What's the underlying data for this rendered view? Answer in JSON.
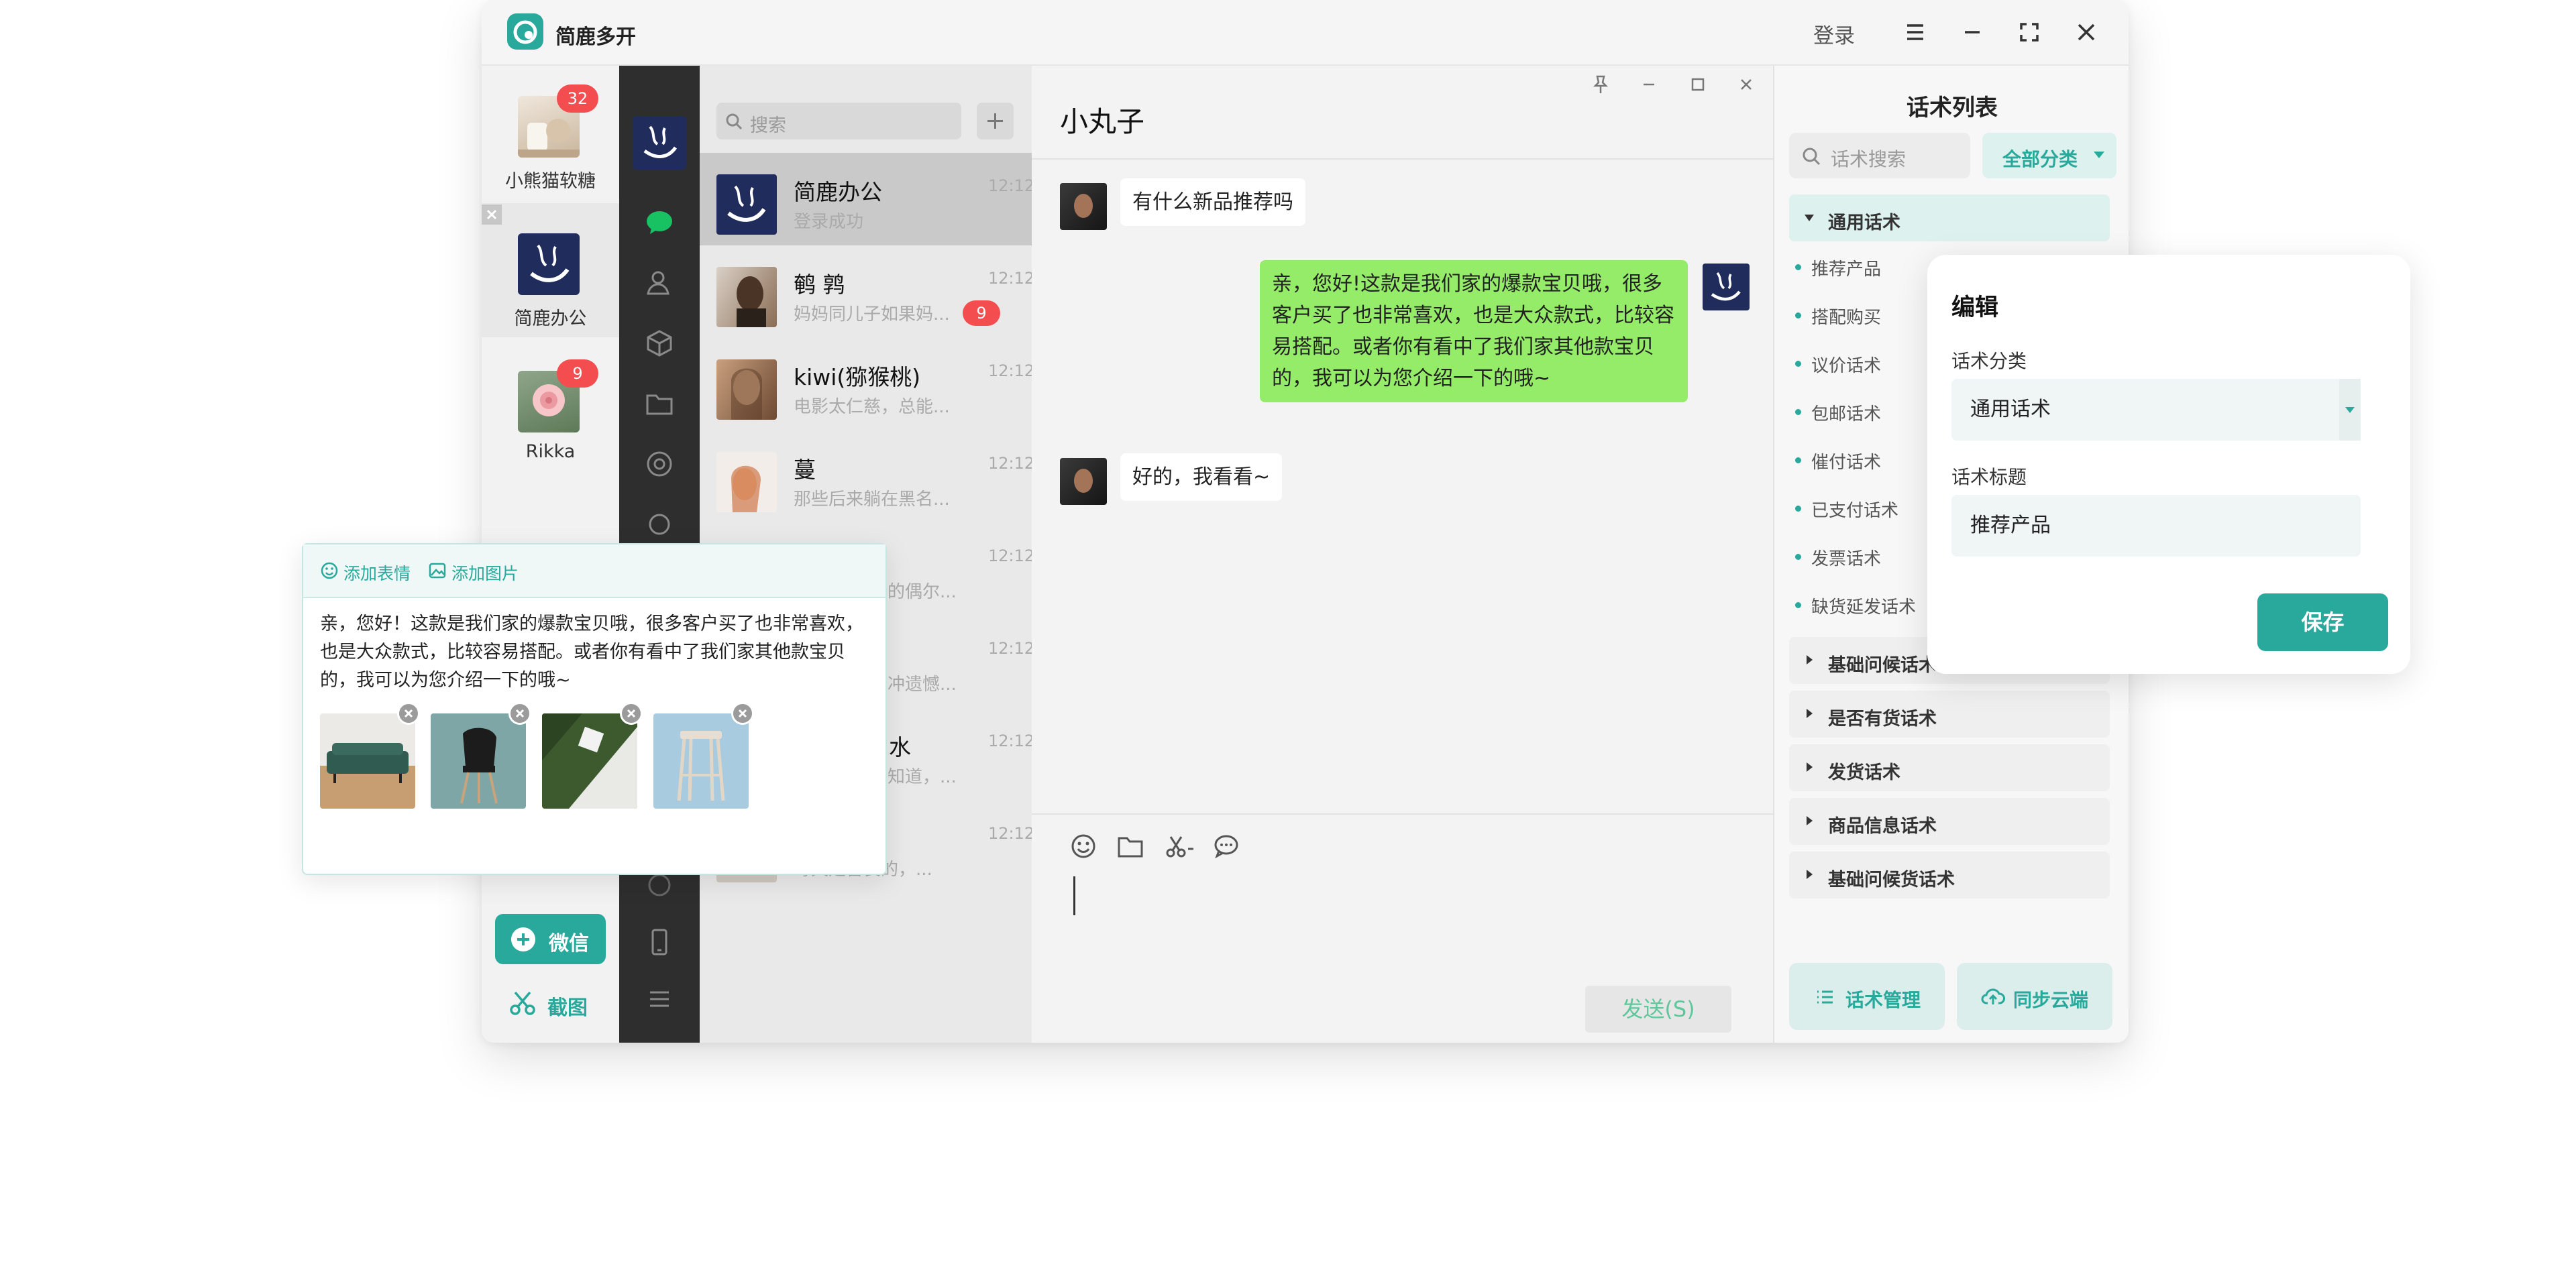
{
  "app": {
    "title": "简鹿多开",
    "login": "登录"
  },
  "accounts": [
    {
      "name": "小熊猫软糖",
      "badge": "32"
    },
    {
      "name": "简鹿办公",
      "badge": ""
    },
    {
      "name": "Rikka",
      "badge": "9"
    }
  ],
  "sidebar": {
    "wechat_label": "微信",
    "capture_label": "截图"
  },
  "chat_list": {
    "search_placeholder": "搜索",
    "items": [
      {
        "name": "简鹿办公",
        "preview": "登录成功",
        "time": "12:12",
        "badge": ""
      },
      {
        "name": "鹌  鹑",
        "preview": "妈妈同儿子如果妈...",
        "time": "12:12",
        "badge": "9"
      },
      {
        "name": "kiwi(猕猴桃)",
        "preview": "电影太仁慈，总能...",
        "time": "12:12",
        "badge": ""
      },
      {
        "name": "蔓",
        "preview": "那些后来躺在黑名...",
        "time": "12:12",
        "badge": ""
      },
      {
        "name": "",
        "preview": "的偶尔...",
        "time": "12:12",
        "badge": ""
      },
      {
        "name": "",
        "preview": "冲遗憾...",
        "time": "12:12",
        "badge": ""
      },
      {
        "name": "水",
        "preview": "知道，...",
        "time": "12:12",
        "badge": ""
      },
      {
        "name": "",
        "preview": "每天是善良的，...",
        "time": "12:12",
        "badge": ""
      }
    ]
  },
  "conversation": {
    "title": "小丸子",
    "messages": [
      {
        "from": "them",
        "text": "有什么新品推荐吗"
      },
      {
        "from": "me",
        "text": "亲，您好!这款是我们家的爆款宝贝哦，很多客户买了也非常喜欢，也是大众款式，比较容易搭配。或者你有看中了我们家其他款宝贝的，我可以为您介绍一下的哦~"
      },
      {
        "from": "them",
        "text": "好的，我看看~"
      }
    ],
    "send_label": "发送(S)"
  },
  "scripts_panel": {
    "title": "话术列表",
    "search_placeholder": "话术搜索",
    "category_label": "全部分类",
    "open_group": "通用话术",
    "sub_items": [
      "推荐产品",
      "搭配购买",
      "议价话术",
      "包邮话术",
      "催付话术",
      "已支付话术",
      "发票话术",
      "缺货延发话术"
    ],
    "groups": [
      "基础问候话术",
      "是否有货话术",
      "发货话术",
      "商品信息话术",
      "基础问候货话术"
    ],
    "manage_label": "话术管理",
    "sync_label": "同步云端"
  },
  "edit_panel": {
    "title": "编辑",
    "category_label": "话术分类",
    "category_value": "通用话术",
    "title_label": "话术标题",
    "title_value": "推荐产品",
    "save_label": "保存"
  },
  "quick_reply": {
    "add_emoji": "添加表情",
    "add_image": "添加图片",
    "text": "亲，您好！这款是我们家的爆款宝贝哦，很多客户买了也非常喜欢，也是大众款式，比较容易搭配。或者你有看中了我们家其他款宝贝的，我可以为您介绍一下的哦~",
    "images": [
      "sofa",
      "chair",
      "abstract",
      "stool"
    ]
  },
  "colors": {
    "accent": "#28a99b",
    "wechat_green": "#95ec69",
    "badge": "#f44d50",
    "dark_sidebar": "#2e2e2e"
  }
}
